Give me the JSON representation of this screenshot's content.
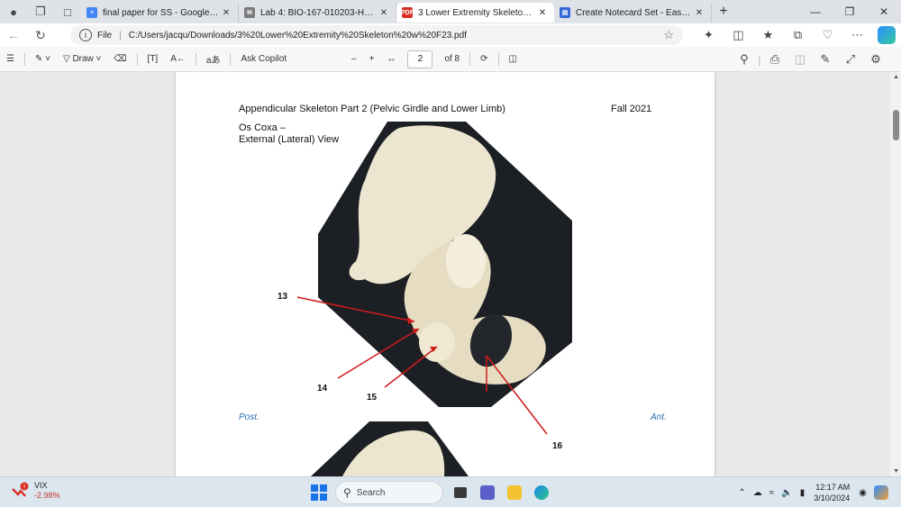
{
  "tabs": [
    {
      "title": "final paper for SS - Google Docs",
      "active": false,
      "fav_color": "#4285f4"
    },
    {
      "title": "Lab 4: BIO-167-010203-Human A",
      "active": false,
      "fav_color": "#7a7a7a"
    },
    {
      "title": "3 Lower Extremity Skeleton w F2",
      "active": true,
      "fav_color": "#d93025"
    },
    {
      "title": "Create Notecard Set - Easy Note",
      "active": false,
      "fav_color": "#3367d6"
    }
  ],
  "address": {
    "scheme_label": "File",
    "url": "C:/Users/jacqu/Downloads/3%20Lower%20Extremity%20Skeleton%20w%20F23.pdf"
  },
  "pdf_toolbar": {
    "draw_label": "Draw",
    "read_aloud": "aあ",
    "copilot_label": "Ask Copilot",
    "page_current": "2",
    "page_total": "of 8"
  },
  "document": {
    "header_left": "Appendicular Skeleton Part 2 (Pelvic Girdle and Lower Limb)",
    "header_right": "Fall 2021",
    "fig_title_1": "Os Coxa –",
    "fig_title_2": "External (Lateral) View",
    "posterior": "Post.",
    "anterior": "Ant.",
    "labels": [
      "13",
      "14",
      "15",
      "16"
    ]
  },
  "taskbar": {
    "ticker": "VIX",
    "ticker_change": "-2.98%",
    "search_placeholder": "Search",
    "time": "12:17 AM",
    "date": "3/10/2024"
  }
}
